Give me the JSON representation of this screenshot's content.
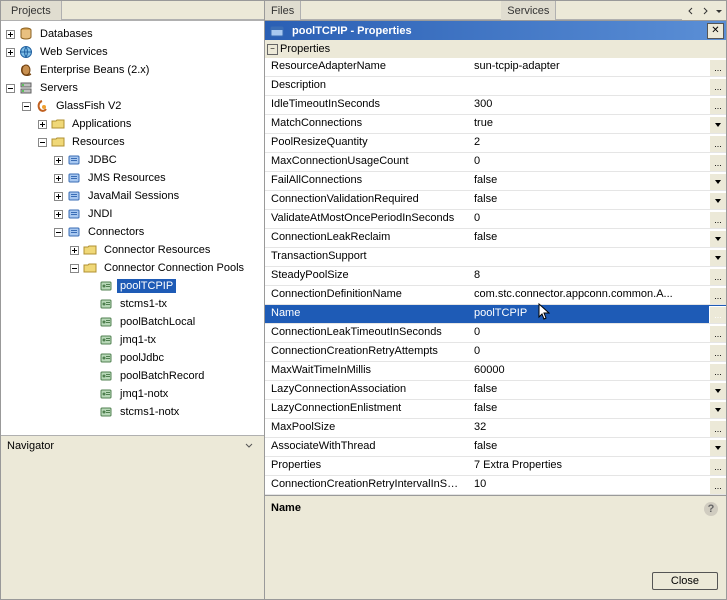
{
  "tabs": {
    "projects": "Projects",
    "files": "Files",
    "services": "Services",
    "navigator": "Navigator"
  },
  "tree": [
    {
      "d": 0,
      "exp": "plus",
      "ic": "db",
      "label": "Databases"
    },
    {
      "d": 0,
      "exp": "plus",
      "ic": "ws",
      "label": "Web Services"
    },
    {
      "d": 0,
      "exp": "none",
      "ic": "eb",
      "label": "Enterprise Beans (2.x)"
    },
    {
      "d": 0,
      "exp": "minus",
      "ic": "srv",
      "label": "Servers"
    },
    {
      "d": 1,
      "exp": "minus",
      "ic": "gf",
      "label": "GlassFish V2"
    },
    {
      "d": 2,
      "exp": "plus",
      "ic": "fold",
      "label": "Applications"
    },
    {
      "d": 2,
      "exp": "minus",
      "ic": "fold",
      "label": "Resources"
    },
    {
      "d": 3,
      "exp": "plus",
      "ic": "res",
      "label": "JDBC"
    },
    {
      "d": 3,
      "exp": "plus",
      "ic": "res",
      "label": "JMS Resources"
    },
    {
      "d": 3,
      "exp": "plus",
      "ic": "res",
      "label": "JavaMail Sessions"
    },
    {
      "d": 3,
      "exp": "plus",
      "ic": "res",
      "label": "JNDI"
    },
    {
      "d": 3,
      "exp": "minus",
      "ic": "res",
      "label": "Connectors"
    },
    {
      "d": 4,
      "exp": "plus",
      "ic": "fold",
      "label": "Connector Resources"
    },
    {
      "d": 4,
      "exp": "minus",
      "ic": "fold",
      "label": "Connector Connection Pools"
    },
    {
      "d": 5,
      "exp": "none",
      "ic": "bean",
      "label": "poolTCPIP",
      "sel": true
    },
    {
      "d": 5,
      "exp": "none",
      "ic": "bean",
      "label": "stcms1-tx"
    },
    {
      "d": 5,
      "exp": "none",
      "ic": "bean",
      "label": "poolBatchLocal"
    },
    {
      "d": 5,
      "exp": "none",
      "ic": "bean",
      "label": "jmq1-tx"
    },
    {
      "d": 5,
      "exp": "none",
      "ic": "bean",
      "label": "poolJdbc"
    },
    {
      "d": 5,
      "exp": "none",
      "ic": "bean",
      "label": "poolBatchRecord"
    },
    {
      "d": 5,
      "exp": "none",
      "ic": "bean",
      "label": "jmq1-notx"
    },
    {
      "d": 5,
      "exp": "none",
      "ic": "bean",
      "label": "stcms1-notx"
    }
  ],
  "dialog": {
    "title": "poolTCPIP - Properties",
    "section": "Properties",
    "selectedName": "Name",
    "close": "Close"
  },
  "props": [
    {
      "n": "ResourceAdapterName",
      "v": "sun-tcpip-adapter",
      "btn": "..."
    },
    {
      "n": "Description",
      "v": "",
      "btn": "..."
    },
    {
      "n": "IdleTimeoutInSeconds",
      "v": "300",
      "btn": "..."
    },
    {
      "n": "MatchConnections",
      "v": "true",
      "btn": "drop"
    },
    {
      "n": "PoolResizeQuantity",
      "v": "2",
      "btn": "..."
    },
    {
      "n": "MaxConnectionUsageCount",
      "v": "0",
      "btn": "..."
    },
    {
      "n": "FailAllConnections",
      "v": "false",
      "btn": "drop"
    },
    {
      "n": "ConnectionValidationRequired",
      "v": "false",
      "btn": "drop"
    },
    {
      "n": "ValidateAtMostOncePeriodInSeconds",
      "v": "0",
      "btn": "..."
    },
    {
      "n": "ConnectionLeakReclaim",
      "v": "false",
      "btn": "drop"
    },
    {
      "n": "TransactionSupport",
      "v": "",
      "btn": "drop"
    },
    {
      "n": "SteadyPoolSize",
      "v": "8",
      "btn": "..."
    },
    {
      "n": "ConnectionDefinitionName",
      "v": "com.stc.connector.appconn.common.A...",
      "btn": "..."
    },
    {
      "n": "Name",
      "v": "poolTCPIP",
      "btn": "...",
      "sel": true
    },
    {
      "n": "ConnectionLeakTimeoutInSeconds",
      "v": "0",
      "btn": "..."
    },
    {
      "n": "ConnectionCreationRetryAttempts",
      "v": "0",
      "btn": "..."
    },
    {
      "n": "MaxWaitTimeInMillis",
      "v": "60000",
      "btn": "..."
    },
    {
      "n": "LazyConnectionAssociation",
      "v": "false",
      "btn": "drop"
    },
    {
      "n": "LazyConnectionEnlistment",
      "v": "false",
      "btn": "drop"
    },
    {
      "n": "MaxPoolSize",
      "v": "32",
      "btn": "..."
    },
    {
      "n": "AssociateWithThread",
      "v": "false",
      "btn": "drop"
    },
    {
      "n": "Properties",
      "v": "7 Extra Properties",
      "btn": "..."
    },
    {
      "n": "ConnectionCreationRetryIntervalInSeconds",
      "v": "10",
      "btn": "..."
    }
  ]
}
